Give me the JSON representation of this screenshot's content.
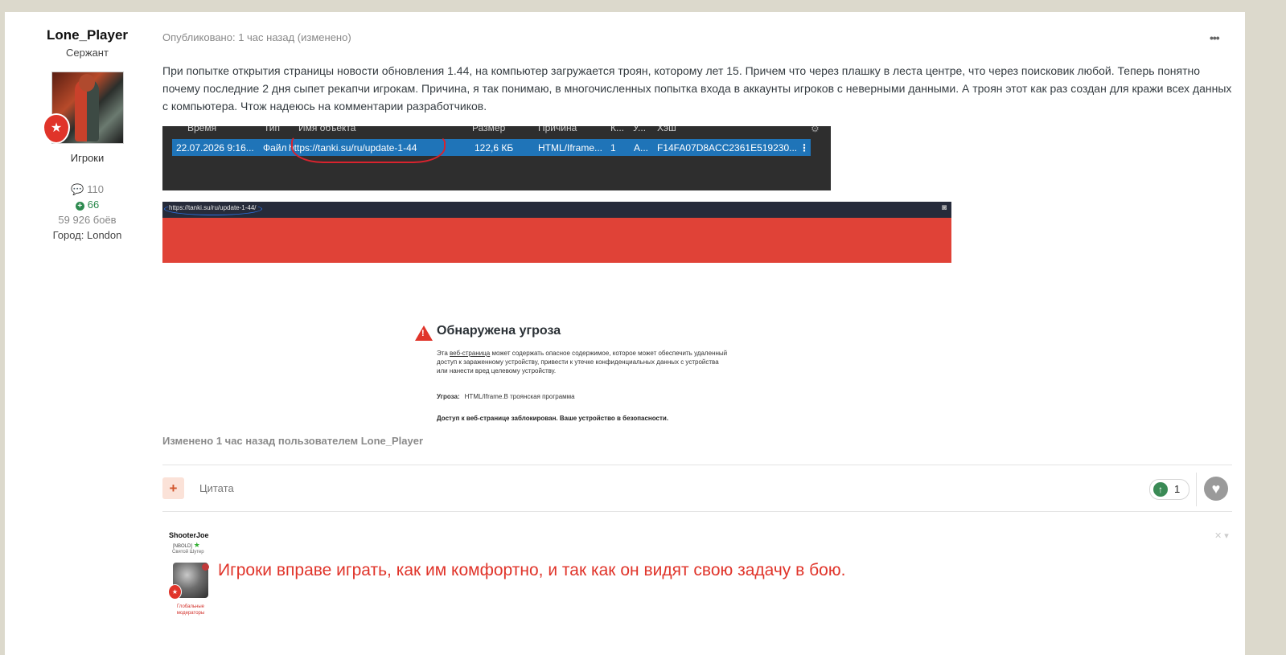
{
  "author": {
    "name": "Lone_Player",
    "rank": "Сержант",
    "group": "Игроки",
    "posts": "110",
    "reputation": "66",
    "battles": "59 926 боёв",
    "city": "Город: London"
  },
  "post": {
    "meta": "Опубликовано: 1 час назад (изменено)",
    "text": "При попытке открытия страницы новости обновления 1.44, на компьютер загружается троян, которому лет 15. Причем что через плашку в леста центре, что через поисковик любой. Теперь понятно почему последние 2 дня сыпет рекапчи игрокам. Причина, я так понимаю, в многочисленных попытка входа в аккаунты игроков с неверными данными. А троян этот как раз создан для кражи всех данных с компьютера. Чтож надеюсь на комментарии разработчиков.",
    "edited": "Изменено 1 час назад пользователем Lone_Player"
  },
  "screenshot_table": {
    "headers": [
      "Время",
      "Тип",
      "Имя объекта",
      "Размер",
      "Причина",
      "К...",
      "У...",
      "Хэш"
    ],
    "row": {
      "time": "22.07.2026 9:16...",
      "type": "Файл",
      "name": "https://tanki.su/ru/update-1-44",
      "size": "122,6 КБ",
      "reason": "HTML/Iframe...",
      "k": "1",
      "u": "A...",
      "hash": "F14FA07D8ACC2361E519230...",
      "menu": "⋮"
    }
  },
  "browser": {
    "url": "https://tanki.su/ru/update-1-44/"
  },
  "threat": {
    "title": "Обнаружена угроза",
    "body_pre": "Эта ",
    "body_link": "веб-страница",
    "body_post": " может содержать опасное содержимое, которое может обеспечить удаленный доступ к зараженному устройству, привести к утечке конфиденциальных данных с устройства или нанести вред целевому устройству.",
    "type_label": "Угроза:",
    "type_value": "HTML/Iframe.B троянская программа",
    "blocked": "Доступ к веб-странице заблокирован. Ваше устройство в безопасности."
  },
  "actions": {
    "quote_label": "Цитата",
    "reputation_count": "1"
  },
  "signature": {
    "name": "ShooterJoe",
    "tag": "[NBOLD]",
    "rank": "Святой Шутер",
    "group": "Глобальные модераторы",
    "text": "Игроки вправе играть, как им комфортно, и так как он видят свою задачу в бою."
  },
  "colors": {
    "accent_red": "#e0342a",
    "selection_blue": "#1f74b8",
    "rep_green": "#2c8a4e"
  }
}
